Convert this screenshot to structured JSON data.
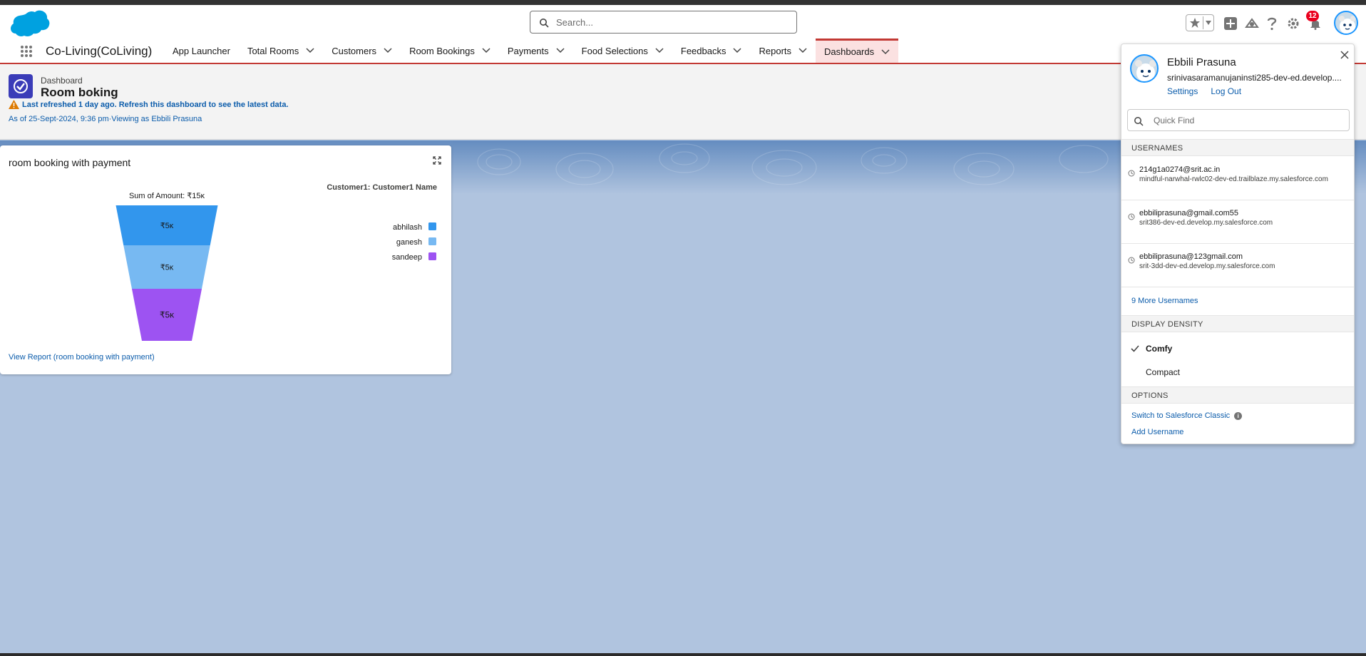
{
  "global_header": {
    "search_placeholder": "Search...",
    "notification_count": "12",
    "icons": [
      "salesforce-cloud-logo",
      "favorites-star-icon",
      "add-icon",
      "trailhead-icon",
      "help-icon",
      "setup-gear-icon",
      "notification-bell-icon",
      "user-avatar"
    ]
  },
  "app_nav": {
    "app_name": "Co-Living(CoLiving)",
    "items": [
      {
        "label": "App Launcher",
        "has_menu": false
      },
      {
        "label": "Total Rooms",
        "has_menu": true
      },
      {
        "label": "Customers",
        "has_menu": true
      },
      {
        "label": "Room Bookings",
        "has_menu": true
      },
      {
        "label": "Payments",
        "has_menu": true
      },
      {
        "label": "Food Selections",
        "has_menu": true
      },
      {
        "label": "Feedbacks",
        "has_menu": true
      },
      {
        "label": "Reports",
        "has_menu": true
      },
      {
        "label": "Dashboards",
        "has_menu": true,
        "active": true
      }
    ]
  },
  "dashboard": {
    "type_label": "Dashboard",
    "title": "Room boking",
    "refresh_warning": "Last refreshed 1 day ago. Refresh this dashboard to see the latest data.",
    "as_of": "As of 25-Sept-2024, 9:36 pm·Viewing as Ebbili Prasuna"
  },
  "widget": {
    "title": "room booking with payment",
    "view_report_link": "View Report (room booking with payment)"
  },
  "chart_data": {
    "type": "funnel",
    "title": "Sum of Amount: ₹15ĸ",
    "legend_title": "Customer1: Customer1 Name",
    "legend_position": "right",
    "categories": [
      "abhilash",
      "ganesh",
      "sandeep"
    ],
    "values": [
      5,
      5,
      5
    ],
    "value_labels": [
      "₹5ĸ",
      "₹5ĸ",
      "₹5ĸ"
    ],
    "unit": "₹ thousands",
    "colors": [
      "#3296ed",
      "#77b9f2",
      "#9d53f2"
    ]
  },
  "profile_panel": {
    "name": "Ebbili Prasuna",
    "org": "srinivasaramanujaninsti285-dev-ed.develop....",
    "settings_link": "Settings",
    "logout_link": "Log Out",
    "quick_find_placeholder": "Quick Find",
    "usernames_header": "USERNAMES",
    "usernames": [
      {
        "user": "214g1a0274@srit.ac.in",
        "domain": "mindful-narwhal-rwlc02-dev-ed.trailblaze.my.salesforce.com"
      },
      {
        "user": "ebbiliprasuna@gmail.com55",
        "domain": "srit386-dev-ed.develop.my.salesforce.com"
      },
      {
        "user": "ebbiliprasuna@123gmail.com",
        "domain": "srit-3dd-dev-ed.develop.my.salesforce.com"
      }
    ],
    "more_usernames": "9 More Usernames",
    "density_header": "DISPLAY DENSITY",
    "density_options": [
      {
        "label": "Comfy",
        "selected": true
      },
      {
        "label": "Compact",
        "selected": false
      }
    ],
    "options_header": "OPTIONS",
    "switch_classic": "Switch to Salesforce Classic",
    "add_username": "Add Username"
  },
  "colors": {
    "brand_blue": "#0b5cab",
    "nav_active_border": "#c23934",
    "dashboard_icon": "#3a3cb8",
    "notification_badge": "#ea001e",
    "page_background": "#b0c4df"
  }
}
